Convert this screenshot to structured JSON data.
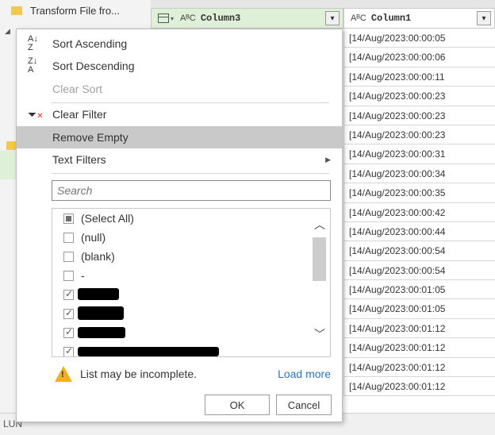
{
  "left_pane": {
    "query_label": "Transform File fro..."
  },
  "status_bar": {
    "text": "LUN"
  },
  "grid": {
    "col3": {
      "type_icon": "AᴮC",
      "name": "Column3"
    },
    "col1": {
      "type_icon": "AᴮC",
      "name": "Column1"
    },
    "rows": [
      "[14/Aug/2023:00:00:05",
      "[14/Aug/2023:00:00:06",
      "[14/Aug/2023:00:00:11",
      "[14/Aug/2023:00:00:23",
      "[14/Aug/2023:00:00:23",
      "[14/Aug/2023:00:00:23",
      "[14/Aug/2023:00:00:31",
      "[14/Aug/2023:00:00:34",
      "[14/Aug/2023:00:00:35",
      "[14/Aug/2023:00:00:42",
      "[14/Aug/2023:00:00:44",
      "[14/Aug/2023:00:00:54",
      "[14/Aug/2023:00:00:54",
      "[14/Aug/2023:00:01:05",
      "[14/Aug/2023:00:01:05",
      "[14/Aug/2023:00:01:12",
      "[14/Aug/2023:00:01:12",
      "[14/Aug/2023:00:01:12",
      "[14/Aug/2023:00:01:12"
    ]
  },
  "menu": {
    "sort_ascending": "Sort Ascending",
    "sort_descending": "Sort Descending",
    "clear_sort": "Clear Sort",
    "clear_filter": "Clear Filter",
    "remove_empty": "Remove Empty",
    "text_filters": "Text Filters",
    "search_placeholder": "Search",
    "list": [
      {
        "label": "(Select All)",
        "state": "partial"
      },
      {
        "label": "(null)",
        "state": "unchecked"
      },
      {
        "label": "(blank)",
        "state": "unchecked"
      },
      {
        "label": "-",
        "state": "unchecked"
      },
      {
        "label": "",
        "state": "checked"
      },
      {
        "label": "",
        "state": "checked"
      },
      {
        "label": "",
        "state": "checked"
      },
      {
        "label": "",
        "state": "checked"
      }
    ],
    "warning": "List may be incomplete.",
    "load_more": "Load more",
    "ok": "OK",
    "cancel": "Cancel"
  },
  "icons": {
    "sort_asc": "sort-ascending-icon",
    "sort_desc": "sort-descending-icon",
    "clear_filter": "clear-filter-icon",
    "warning": "warning-icon",
    "filter": "filter-dropdown-icon",
    "table": "table-icon"
  },
  "colors": {
    "selected_column": "#dff0d8",
    "hover_item": "#c9c9c9",
    "link": "#2e74b5",
    "warning": "#f2b01e"
  }
}
